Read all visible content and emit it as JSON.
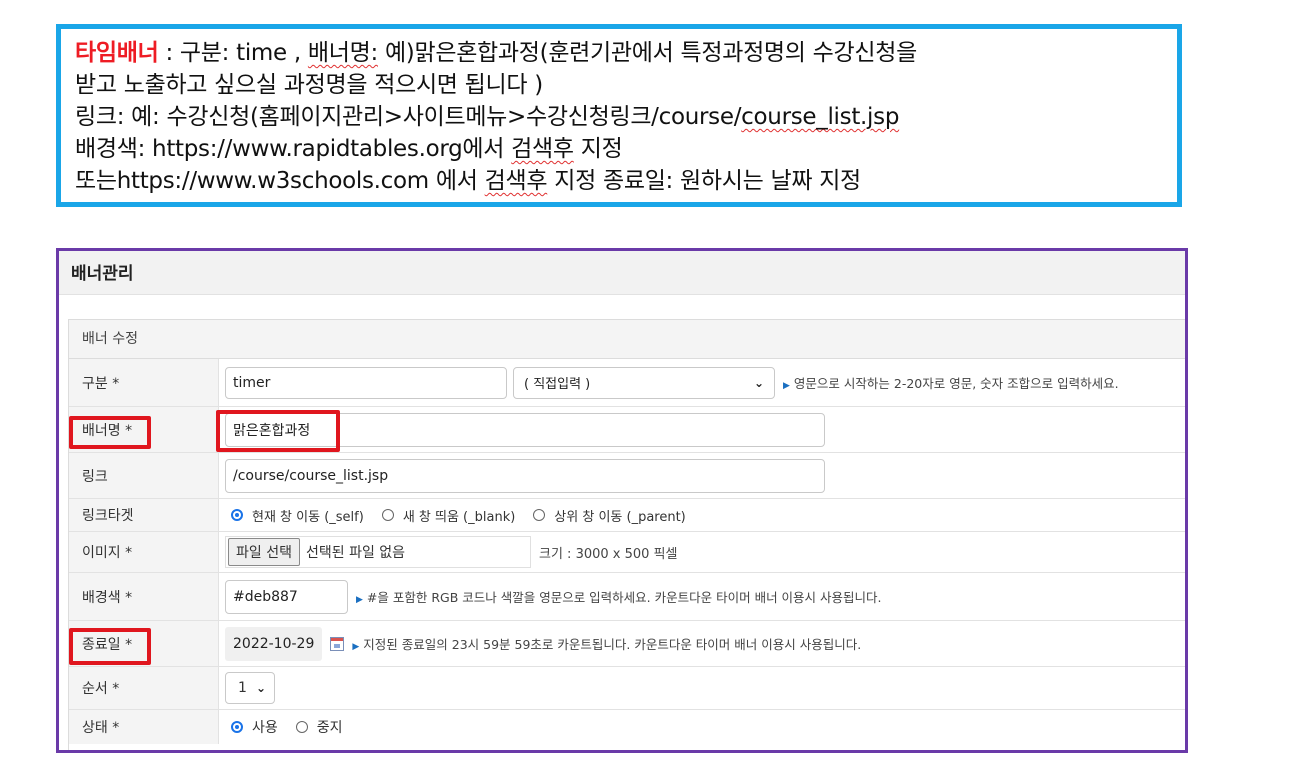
{
  "note": {
    "line1_highlight": "타임배너",
    "line1_rest_a": " : 구분: time , ",
    "line1_squiggle": "배너명:",
    "line1_rest_b": " 예)맑은혼합과정(훈련기관에서 특정과정명의 수강신청을",
    "line2": "받고 노출하고 싶으실 과정명을 적으시면 됩니다 )",
    "line3_a": "링크: 예: 수강신청(홈페이지관리>사이트메뉴>수강신청링크/course/",
    "line3_squiggle": "course_list.jsp",
    "line4_a": "배경색: https://www.rapidtables.org에서 ",
    "line4_squiggle": "검색후",
    "line4_b": " 지정",
    "line5_a": "또는https://www.w3schools.com 에서 ",
    "line5_squiggle": "검색후",
    "line5_b": " 지정 종료일: 원하시는 날짜 지정"
  },
  "panel": {
    "title": "배너관리",
    "section_title": "배너 수정"
  },
  "form": {
    "type": {
      "label": "구분 *",
      "value": "timer",
      "select_value": "( 직접입력 )",
      "hint": "영문으로 시작하는 2-20자로 영문, 숫자 조합으로 입력하세요."
    },
    "name": {
      "label": "배너명 *",
      "value": "맑은혼합과정"
    },
    "link": {
      "label": "링크",
      "value": "/course/course_list.jsp"
    },
    "target": {
      "label": "링크타겟",
      "options": [
        "현재 창 이동 (_self)",
        "새 창 띄움 (_blank)",
        "상위 창 이동 (_parent)"
      ]
    },
    "image": {
      "label": "이미지 *",
      "button": "파일 선택",
      "none": "선택된 파일 없음",
      "size": "크기 : 3000 x 500 픽셀"
    },
    "bgcolor": {
      "label": "배경색 *",
      "value": "#deb887",
      "hint": "#을 포함한 RGB 코드나 색깔을 영문으로 입력하세요. 카운트다운 타이머 배너 이용시 사용됩니다."
    },
    "enddate": {
      "label": "종료일 *",
      "value": "2022-10-29",
      "hint": "지정된 종료일의 23시 59분 59초로 카운트됩니다. 카운트다운 타이머 배너 이용시 사용됩니다."
    },
    "order": {
      "label": "순서 *",
      "value": "1"
    },
    "status": {
      "label": "상태 *",
      "options": [
        "사용",
        "중지"
      ]
    }
  },
  "colors": {
    "note_border": "#1aa6e8",
    "panel_border": "#6a3aa8",
    "highlight_box": "#e0161e",
    "radio_accent": "#1a73e8"
  }
}
